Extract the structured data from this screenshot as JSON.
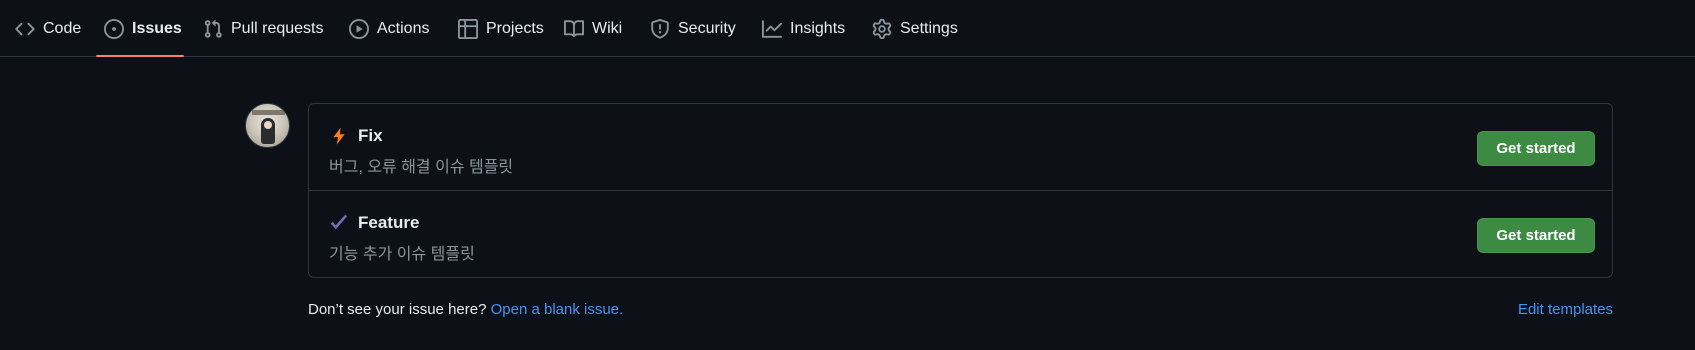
{
  "nav": {
    "tabs": [
      {
        "label": "Code",
        "icon": "code-icon"
      },
      {
        "label": "Issues",
        "icon": "issue-opened-icon",
        "active": true
      },
      {
        "label": "Pull requests",
        "icon": "git-pull-request-icon"
      },
      {
        "label": "Actions",
        "icon": "play-icon"
      },
      {
        "label": "Projects",
        "icon": "table-icon"
      },
      {
        "label": "Wiki",
        "icon": "book-icon"
      },
      {
        "label": "Security",
        "icon": "shield-icon"
      },
      {
        "label": "Insights",
        "icon": "graph-icon"
      },
      {
        "label": "Settings",
        "icon": "gear-icon"
      }
    ],
    "active_underline_color": "#f78166"
  },
  "templates": [
    {
      "title": "Fix",
      "emoji": "zap-icon",
      "description": "버그, 오류 해결 이슈 템플릿",
      "button": "Get started"
    },
    {
      "title": "Feature",
      "emoji": "heavy-check-mark-icon",
      "description": "기능 추가 이슈 템플릿",
      "button": "Get started"
    }
  ],
  "footer": {
    "prompt": "Don’t see your issue here?",
    "blank_link": "Open a blank issue.",
    "edit_link": "Edit templates"
  },
  "colors": {
    "background": "#0d1117",
    "border": "#30363d",
    "text": "#e6edf3",
    "muted": "#8b949e",
    "link": "#4493f8",
    "button": "#3d8b43"
  }
}
